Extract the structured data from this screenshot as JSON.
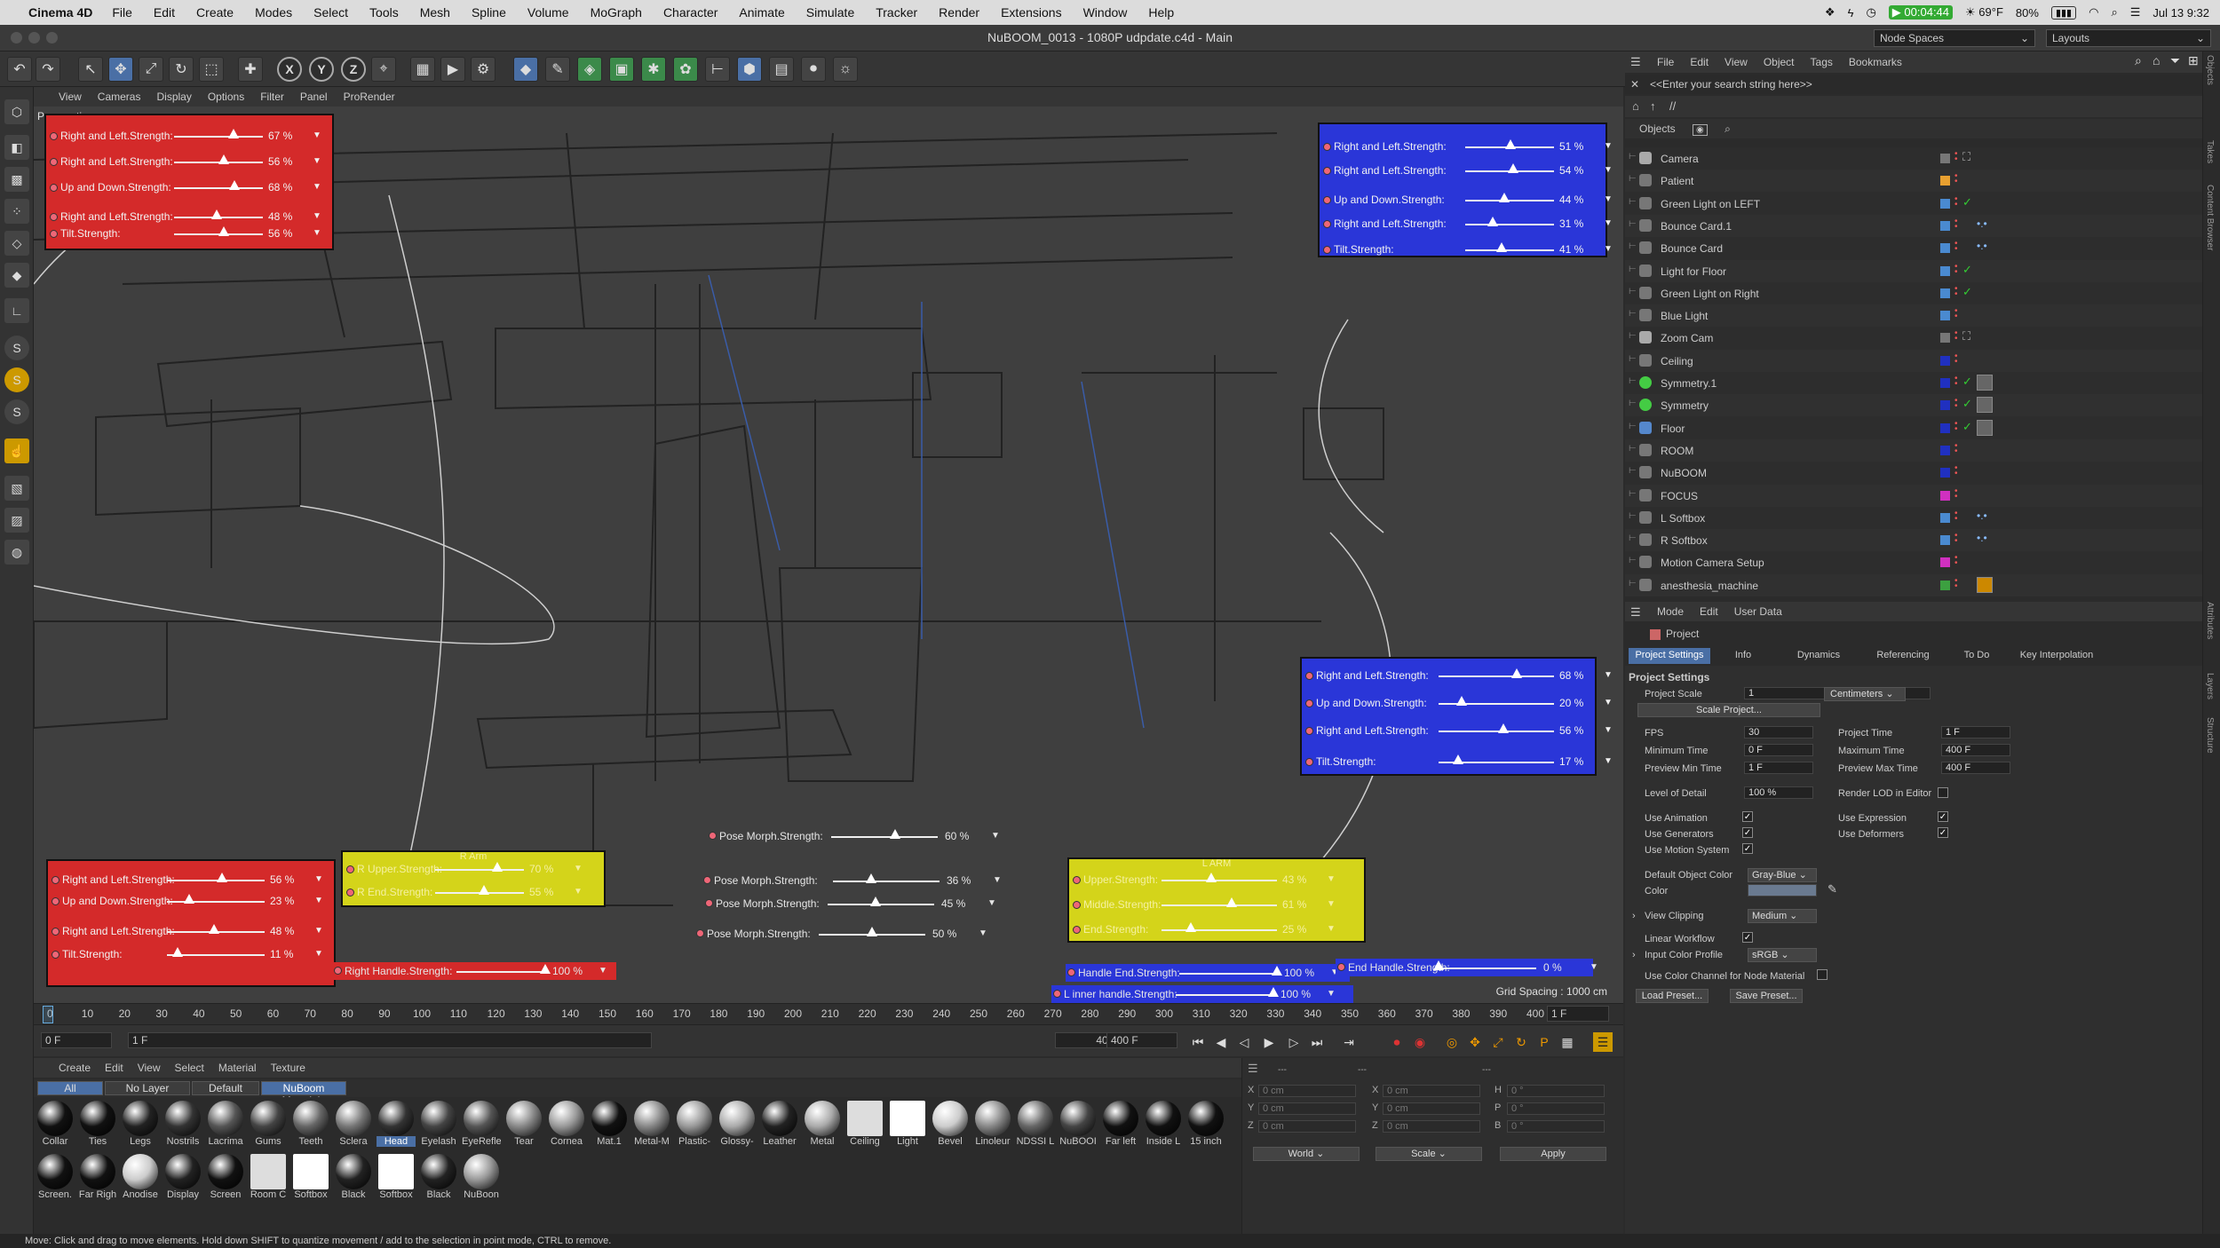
{
  "menubar": {
    "app": "Cinema 4D",
    "items": [
      "File",
      "Edit",
      "Create",
      "Modes",
      "Select",
      "Tools",
      "Mesh",
      "Spline",
      "Volume",
      "MoGraph",
      "Character",
      "Animate",
      "Simulate",
      "Tracker",
      "Render",
      "Extensions",
      "Window",
      "Help"
    ],
    "timer": "00:04:44",
    "weather": "69°F",
    "battery": "80%",
    "datetime": "Jul 13  9:32"
  },
  "window": {
    "title": "NuBOOM_0013 - 1080P  udpdate.c4d - Main",
    "node_spaces": "Node Spaces",
    "layouts": "Layouts"
  },
  "viewport": {
    "menu": [
      "View",
      "Cameras",
      "Display",
      "Options",
      "Filter",
      "Panel",
      "ProRender"
    ],
    "camera_label": "Perspective",
    "grid_spacing": "Grid Spacing : 1000 cm",
    "panel_top_left": [
      {
        "name": "Right and Left.Strength:",
        "pct": 67,
        "value": "67 %"
      },
      {
        "name": "Right and Left.Strength:",
        "pct": 56,
        "value": "56 %"
      },
      {
        "name": "Up and Down.Strength:",
        "pct": 68,
        "value": "68 %"
      },
      {
        "name": "Right and Left.Strength:",
        "pct": 48,
        "value": "48 %"
      },
      {
        "name": "Tilt.Strength:",
        "pct": 56,
        "value": "56 %"
      }
    ],
    "panel_top_right": [
      {
        "name": "Right and Left.Strength:",
        "pct": 51,
        "value": "51 %"
      },
      {
        "name": "Right and Left.Strength:",
        "pct": 54,
        "value": "54 %"
      },
      {
        "name": "Up and Down.Strength:",
        "pct": 44,
        "value": "44 %"
      },
      {
        "name": "Right and Left.Strength:",
        "pct": 31,
        "value": "31 %"
      },
      {
        "name": "Tilt.Strength:",
        "pct": 41,
        "value": "41 %"
      }
    ],
    "panel_mid_right": [
      {
        "name": "Right and Left.Strength:",
        "pct": 68,
        "value": "68 %"
      },
      {
        "name": "Up and Down.Strength:",
        "pct": 20,
        "value": "20 %"
      },
      {
        "name": "Right and Left.Strength:",
        "pct": 56,
        "value": "56 %"
      },
      {
        "name": "Tilt.Strength:",
        "pct": 17,
        "value": "17 %"
      }
    ],
    "panel_bottom_left": [
      {
        "name": "Right and Left.Strength:",
        "pct": 56,
        "value": "56 %"
      },
      {
        "name": "Up and Down.Strength:",
        "pct": 23,
        "value": "23 %"
      },
      {
        "name": "Right and Left.Strength:",
        "pct": 48,
        "value": "48 %"
      },
      {
        "name": "Tilt.Strength:",
        "pct": 11,
        "value": "11 %"
      }
    ],
    "r_arm": {
      "title": "R Arm",
      "rows": [
        {
          "name": "R Upper.Strength:",
          "pct": 70,
          "value": "70 %"
        },
        {
          "name": "R End.Strength:",
          "pct": 55,
          "value": "55 %"
        }
      ]
    },
    "l_arm": {
      "title": "L ARM",
      "rows": [
        {
          "name": "Upper.Strength:",
          "pct": 43,
          "value": "43 %"
        },
        {
          "name": "Middle.Strength:",
          "pct": 61,
          "value": "61 %"
        },
        {
          "name": "End.Strength:",
          "pct": 25,
          "value": "25 %"
        }
      ]
    },
    "pose_morphs": [
      {
        "name": "Pose Morph.Strength:",
        "pct": 60,
        "value": "60 %"
      },
      {
        "name": "Pose Morph.Strength:",
        "pct": 36,
        "value": "36 %"
      },
      {
        "name": "Pose Morph.Strength:",
        "pct": 45,
        "value": "45 %"
      },
      {
        "name": "Pose Morph.Strength:",
        "pct": 50,
        "value": "50 %"
      }
    ],
    "handles": [
      {
        "name": "Right Handle.Strength:",
        "pct": 100,
        "value": "100 %"
      },
      {
        "name": "Handle End.Strength:",
        "pct": 100,
        "value": "100 %"
      },
      {
        "name": "L inner handle.Strength:",
        "pct": 100,
        "value": "100 %"
      },
      {
        "name": "End Handle.Strength:",
        "pct": 0,
        "value": "0 %"
      }
    ]
  },
  "timeline": {
    "ticks": [
      "0",
      "10",
      "20",
      "30",
      "40",
      "50",
      "60",
      "70",
      "80",
      "90",
      "100",
      "110",
      "120",
      "130",
      "140",
      "150",
      "160",
      "170",
      "180",
      "190",
      "200",
      "210",
      "220",
      "230",
      "240",
      "250",
      "260",
      "270",
      "280",
      "290",
      "300",
      "310",
      "320",
      "330",
      "340",
      "350",
      "360",
      "370",
      "380",
      "390",
      "400"
    ],
    "current_frame": "1 F",
    "start": "0 F",
    "frame": "1 F",
    "end_a": "400 F",
    "end_b": "400 F"
  },
  "materials": {
    "menu": [
      "Create",
      "Edit",
      "View",
      "Select",
      "Material",
      "Texture"
    ],
    "tabs": [
      "All",
      "No Layer",
      "Default",
      "NuBoom Materials"
    ],
    "row1": [
      {
        "n": "Collar",
        "c": "#111"
      },
      {
        "n": "Ties",
        "c": "#111"
      },
      {
        "n": "Legs",
        "c": "#222"
      },
      {
        "n": "Nostrils",
        "c": "#333"
      },
      {
        "n": "Lacrima",
        "c": "#555"
      },
      {
        "n": "Gums",
        "c": "#444"
      },
      {
        "n": "Teeth",
        "c": "#666"
      },
      {
        "n": "Sclera",
        "c": "#777"
      },
      {
        "n": "Head",
        "c": "#333"
      },
      {
        "n": "Eyelash",
        "c": "#444"
      },
      {
        "n": "EyeRefle",
        "c": "#555"
      },
      {
        "n": "Tear",
        "c": "#888"
      },
      {
        "n": "Cornea",
        "c": "#999"
      },
      {
        "n": "Mat.1",
        "c": "#111"
      },
      {
        "n": "Metal-M",
        "c": "#888"
      },
      {
        "n": "Plastic-",
        "c": "#999"
      },
      {
        "n": "Glossy-",
        "c": "#aaa"
      },
      {
        "n": "Leather",
        "c": "#222"
      },
      {
        "n": "Metal",
        "c": "#aaa"
      },
      {
        "n": "Ceiling",
        "c": "#ddd"
      },
      {
        "n": "Light",
        "c": "#fff"
      },
      {
        "n": "Bevel",
        "c": "#ccc"
      },
      {
        "n": "Linoleur",
        "c": "#888"
      },
      {
        "n": "NDSSI L",
        "c": "#666"
      },
      {
        "n": "NuBOOI",
        "c": "#444"
      },
      {
        "n": "Far left",
        "c": "#111"
      },
      {
        "n": "Inside L",
        "c": "#111"
      },
      {
        "n": "15 inch",
        "c": "#111"
      }
    ],
    "row2": [
      {
        "n": "Screen.",
        "c": "#111"
      },
      {
        "n": "Far Righ",
        "c": "#111"
      },
      {
        "n": "Anodise",
        "c": "#ccc"
      },
      {
        "n": "Display",
        "c": "#222"
      },
      {
        "n": "Screen",
        "c": "#111"
      },
      {
        "n": "Room C",
        "c": "#ddd"
      },
      {
        "n": "Softbox",
        "c": "#fff"
      },
      {
        "n": "Black",
        "c": "#222"
      },
      {
        "n": "Softbox",
        "c": "#fff"
      },
      {
        "n": "Black",
        "c": "#222"
      },
      {
        "n": "NuBoon",
        "c": "#999"
      }
    ]
  },
  "coords": {
    "rows": [
      [
        "X",
        "0 cm",
        "X",
        "0 cm",
        "H",
        "0 °"
      ],
      [
        "Y",
        "0 cm",
        "Y",
        "0 cm",
        "P",
        "0 °"
      ],
      [
        "Z",
        "0 cm",
        "Z",
        "0 cm",
        "B",
        "0 °"
      ]
    ],
    "world": "World",
    "scale": "Scale",
    "apply": "Apply"
  },
  "status": "Move: Click and drag to move elements. Hold down SHIFT to quantize movement / add to the selection in point mode, CTRL to remove.",
  "objects": {
    "menu": [
      "File",
      "Edit",
      "View",
      "Object",
      "Tags",
      "Bookmarks"
    ],
    "search_placeholder": "<<Enter your search string here>>",
    "header": "Objects",
    "items": [
      {
        "n": "Camera",
        "c": "#777",
        "t": "cam"
      },
      {
        "n": "Patient",
        "c": "#e8a030",
        "t": ""
      },
      {
        "n": "Green Light on LEFT",
        "c": "#4a8ad0",
        "t": "chk"
      },
      {
        "n": "Bounce Card.1",
        "c": "#4a8ad0",
        "t": "tag"
      },
      {
        "n": "Bounce Card",
        "c": "#4a8ad0",
        "t": "tag"
      },
      {
        "n": "Light for Floor",
        "c": "#4a8ad0",
        "t": "chk"
      },
      {
        "n": "Green Light on Right",
        "c": "#4a8ad0",
        "t": "chk"
      },
      {
        "n": "Blue Light",
        "c": "#4a8ad0",
        "t": ""
      },
      {
        "n": "Zoom Cam",
        "c": "#777",
        "t": "cam"
      },
      {
        "n": "Ceiling",
        "c": "#2030c0",
        "t": ""
      },
      {
        "n": "Symmetry.1",
        "c": "#2030c0",
        "t": "tag"
      },
      {
        "n": "Symmetry",
        "c": "#2030c0",
        "t": "tag"
      },
      {
        "n": "Floor",
        "c": "#2030c0",
        "t": "tag"
      },
      {
        "n": "ROOM",
        "c": "#2030c0",
        "t": ""
      },
      {
        "n": "NuBOOM",
        "c": "#2030c0",
        "t": ""
      },
      {
        "n": "FOCUS",
        "c": "#d030c0",
        "t": ""
      },
      {
        "n": "L Softbox",
        "c": "#4a8ad0",
        "t": "tag"
      },
      {
        "n": "R Softbox",
        "c": "#4a8ad0",
        "t": "tag"
      },
      {
        "n": "Motion Camera Setup",
        "c": "#d030c0",
        "t": ""
      },
      {
        "n": "anesthesia_machine",
        "c": "#3ca040",
        "t": "tag"
      }
    ]
  },
  "attributes": {
    "menu": [
      "Mode",
      "Edit",
      "User Data"
    ],
    "title": "Project",
    "tabs": [
      "Project Settings",
      "Info",
      "Dynamics",
      "Referencing",
      "To Do",
      "Key Interpolation"
    ],
    "section": "Project Settings",
    "project_scale_label": "Project Scale",
    "project_scale": "1",
    "units": "Centimeters",
    "scale_project": "Scale Project...",
    "fps_label": "FPS",
    "fps": "30",
    "project_time_label": "Project Time",
    "project_time": "1 F",
    "min_time_label": "Minimum Time",
    "min_time": "0 F",
    "max_time_label": "Maximum Time",
    "max_time": "400 F",
    "prev_min_label": "Preview Min Time",
    "prev_min": "1 F",
    "prev_max_label": "Preview Max Time",
    "prev_max": "400 F",
    "lod_label": "Level of Detail",
    "lod": "100 %",
    "render_lod_label": "Render LOD in Editor",
    "use_anim": "Use Animation",
    "use_expr": "Use Expression",
    "use_gen": "Use Generators",
    "use_def": "Use Deformers",
    "use_motion": "Use Motion System",
    "def_obj_color_label": "Default Object Color",
    "def_obj_color": "Gray-Blue",
    "color_label": "Color",
    "view_clip_label": "View Clipping",
    "view_clip": "Medium",
    "linear_wf": "Linear Workflow",
    "input_profile_label": "Input Color Profile",
    "input_profile": "sRGB",
    "use_color_channel": "Use Color Channel for Node Material",
    "load_preset": "Load Preset...",
    "save_preset": "Save Preset..."
  },
  "side_tabs": [
    "Objects",
    "Takes",
    "Content Browser",
    "Attributes",
    "Layers",
    "Structure"
  ]
}
